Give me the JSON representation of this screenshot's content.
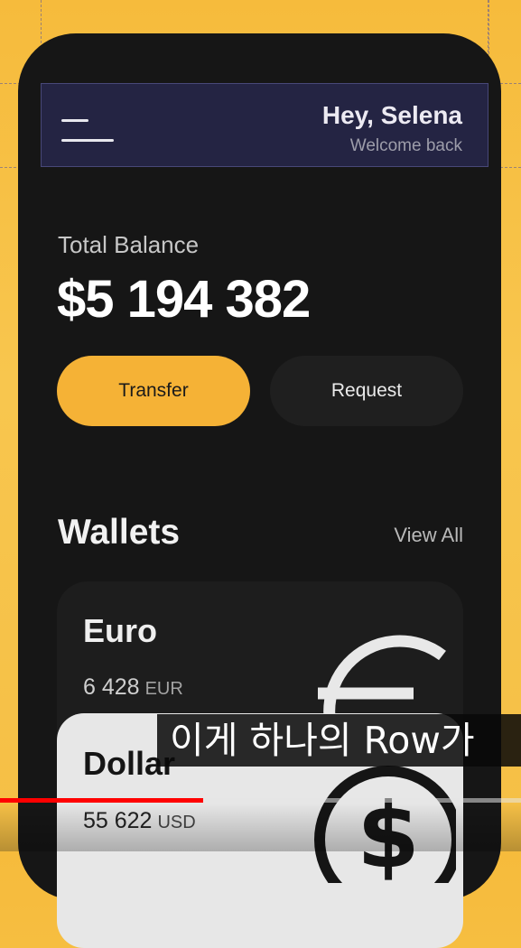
{
  "header": {
    "greeting": "Hey, Selena",
    "subtitle": "Welcome back",
    "menu_icon": "hamburger-menu-icon"
  },
  "balance": {
    "label": "Total Balance",
    "value": "$5 194 382"
  },
  "actions": {
    "transfer_label": "Transfer",
    "request_label": "Request"
  },
  "wallets": {
    "title": "Wallets",
    "view_all_label": "View All",
    "items": [
      {
        "name": "Euro",
        "amount": "6 428",
        "currency": "EUR",
        "icon": "euro-icon"
      },
      {
        "name": "Dollar",
        "amount": "55 622",
        "currency": "USD",
        "icon": "dollar-icon"
      }
    ]
  },
  "video": {
    "caption": "이게 하나의 Row가",
    "progress_fraction": 0.39
  },
  "colors": {
    "accent": "#f5b236",
    "background": "#f6bb3c",
    "phone": "#161616",
    "progress": "#ff0000"
  }
}
